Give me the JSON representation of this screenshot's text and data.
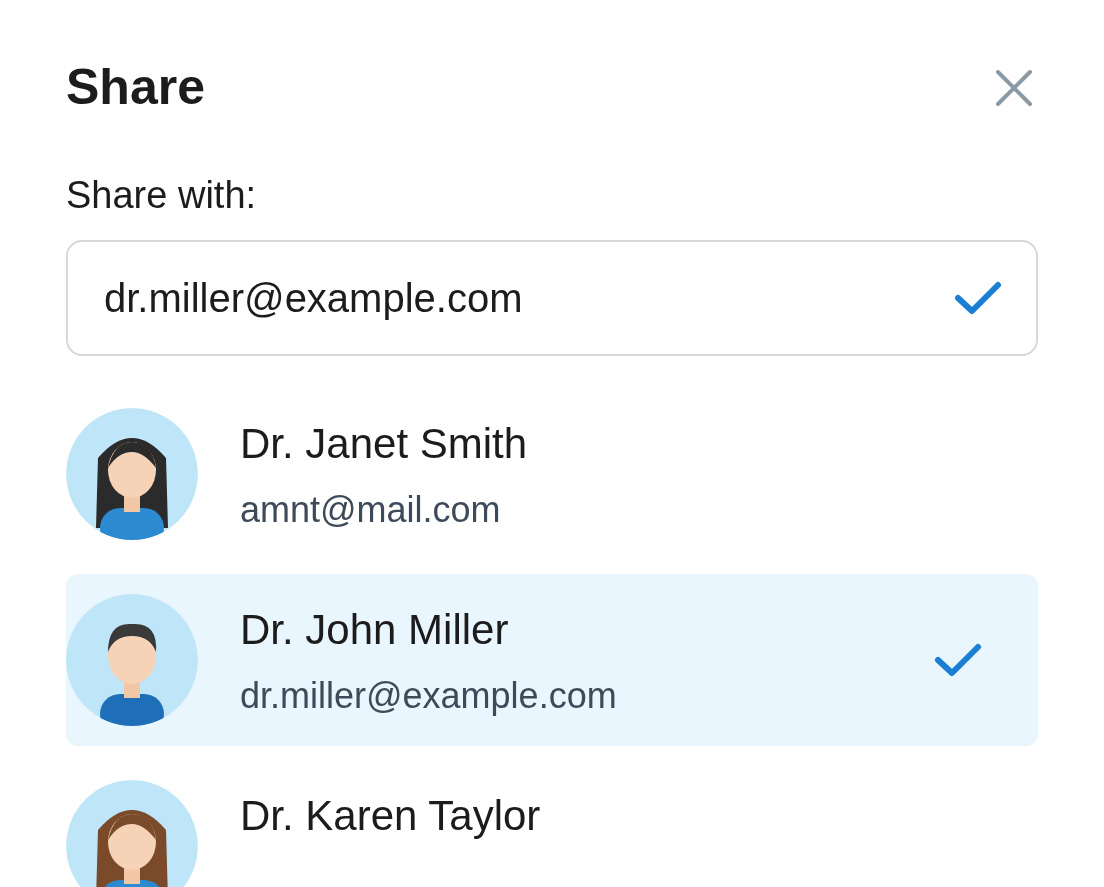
{
  "title": "Share",
  "share_with": {
    "label": "Share with:",
    "value": "dr.miller@example.com",
    "valid": true
  },
  "contacts": [
    {
      "name": "Dr. Janet Smith",
      "email": "amnt@mail.com",
      "selected": false,
      "kind": "female-dark"
    },
    {
      "name": "Dr. John Miller",
      "email": "dr.miller@example.com",
      "selected": true,
      "kind": "male"
    },
    {
      "name": "Dr. Karen Taylor",
      "selected": false,
      "kind": "female-brown"
    }
  ]
}
